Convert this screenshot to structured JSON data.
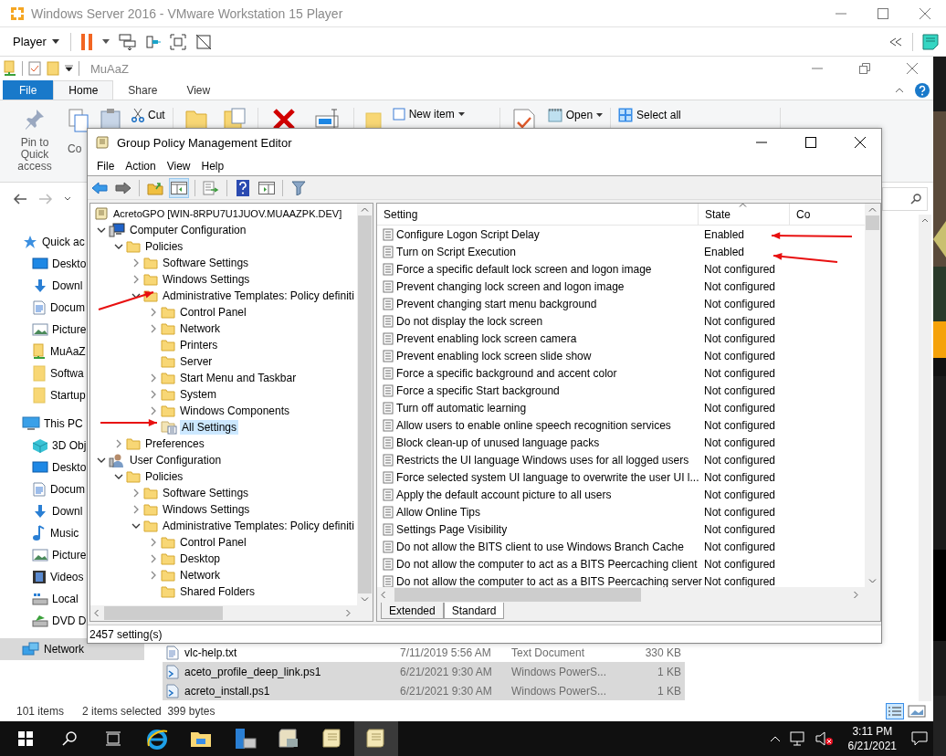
{
  "vmware": {
    "title": "Windows Server 2016 - VMware Workstation 15 Player",
    "menu": "Player"
  },
  "explorer": {
    "title": "MuAaZ",
    "tabs": [
      {
        "label": "File",
        "kind": "file",
        "selected": false
      },
      {
        "label": "Home",
        "kind": "tab",
        "selected": true
      },
      {
        "label": "Share",
        "kind": "tab",
        "selected": false
      },
      {
        "label": "View",
        "kind": "tab",
        "selected": false
      }
    ],
    "ribbon": {
      "pin": "Pin to Quick access",
      "copy": "Co",
      "cut": "Cut",
      "new_item": "New item",
      "open": "Open",
      "select_all": "Select all"
    },
    "nav": [
      {
        "label": "Quick ac",
        "kind": "star",
        "selected": false,
        "children": [
          {
            "label": "Deskto",
            "kind": "desktop",
            "selected": false
          },
          {
            "label": "Downl",
            "kind": "download",
            "selected": false
          },
          {
            "label": "Docum",
            "kind": "doc",
            "selected": false
          },
          {
            "label": "Picture",
            "kind": "pictures",
            "selected": false
          },
          {
            "label": "MuAaZ",
            "kind": "share",
            "selected": false
          },
          {
            "label": "Softwa",
            "kind": "folder",
            "selected": false
          },
          {
            "label": "Startup",
            "kind": "folder",
            "selected": false
          }
        ]
      },
      {
        "label": "This PC",
        "kind": "pc",
        "selected": false,
        "children": [
          {
            "label": "3D Obj",
            "kind": "cube",
            "selected": false
          },
          {
            "label": "Deskto",
            "kind": "desktop",
            "selected": false
          },
          {
            "label": "Docum",
            "kind": "doc",
            "selected": false
          },
          {
            "label": "Downl",
            "kind": "download",
            "selected": false
          },
          {
            "label": "Music",
            "kind": "music",
            "selected": false
          },
          {
            "label": "Picture",
            "kind": "pictures",
            "selected": false
          },
          {
            "label": "Videos",
            "kind": "video",
            "selected": false
          },
          {
            "label": "Local",
            "kind": "drive",
            "selected": false
          },
          {
            "label": "DVD D",
            "kind": "dvd",
            "selected": false
          }
        ]
      },
      {
        "label": "Network",
        "kind": "network",
        "selected": true
      }
    ],
    "files": [
      {
        "name": "vlc-help.txt",
        "kind": "text",
        "date": "7/11/2019 5:56 AM",
        "type": "Text Document",
        "size": "330 KB",
        "selected": false
      },
      {
        "name": "aceto_profile_deep_link.ps1",
        "kind": "script",
        "date": "6/21/2021 9:30 AM",
        "type": "Windows PowerS...",
        "size": "1 KB",
        "selected": true
      },
      {
        "name": "acreto_install.ps1",
        "kind": "script",
        "date": "6/21/2021 9:30 AM",
        "type": "Windows PowerS...",
        "size": "1 KB",
        "selected": true
      }
    ],
    "status": {
      "count": "101 items",
      "selection": "2 items selected  399 bytes"
    }
  },
  "gpme": {
    "title": "Group Policy Management Editor",
    "menu": [
      "File",
      "Action",
      "View",
      "Help"
    ],
    "tree": [
      {
        "label": "AcretoGPO [WIN-8RPU7U1JUOV.MUAAZPK.DEV]",
        "kind": "root",
        "selected": false,
        "children": [
          {
            "label": "Computer Configuration",
            "kind": "computer",
            "expanded": true,
            "selected": false,
            "children": [
              {
                "label": "Policies",
                "kind": "folder",
                "expanded": true,
                "selected": false,
                "children": [
                  {
                    "label": "Software Settings",
                    "kind": "folder",
                    "expanded": false,
                    "selected": false
                  },
                  {
                    "label": "Windows Settings",
                    "kind": "folder",
                    "expanded": false,
                    "selected": false
                  },
                  {
                    "label": "Administrative Templates: Policy definiti",
                    "kind": "folder",
                    "expanded": true,
                    "selected": false,
                    "children": [
                      {
                        "label": "Control Panel",
                        "kind": "folder",
                        "expanded": false,
                        "selected": false
                      },
                      {
                        "label": "Network",
                        "kind": "folder",
                        "expanded": false,
                        "selected": false
                      },
                      {
                        "label": "Printers",
                        "kind": "folder",
                        "selected": false
                      },
                      {
                        "label": "Server",
                        "kind": "folder",
                        "selected": false
                      },
                      {
                        "label": "Start Menu and Taskbar",
                        "kind": "folder",
                        "expanded": false,
                        "selected": false
                      },
                      {
                        "label": "System",
                        "kind": "folder",
                        "expanded": false,
                        "selected": false
                      },
                      {
                        "label": "Windows Components",
                        "kind": "folder",
                        "expanded": false,
                        "selected": false
                      },
                      {
                        "label": "All Settings",
                        "kind": "settings",
                        "selected": true
                      }
                    ]
                  }
                ]
              },
              {
                "label": "Preferences",
                "kind": "folder",
                "expanded": false,
                "selected": false
              }
            ]
          },
          {
            "label": "User Configuration",
            "kind": "user",
            "expanded": true,
            "selected": false,
            "children": [
              {
                "label": "Policies",
                "kind": "folder",
                "expanded": true,
                "selected": false,
                "children": [
                  {
                    "label": "Software Settings",
                    "kind": "folder",
                    "expanded": false,
                    "selected": false
                  },
                  {
                    "label": "Windows Settings",
                    "kind": "folder",
                    "expanded": false,
                    "selected": false
                  },
                  {
                    "label": "Administrative Templates: Policy definiti",
                    "kind": "folder",
                    "expanded": true,
                    "selected": false,
                    "children": [
                      {
                        "label": "Control Panel",
                        "kind": "folder",
                        "expanded": false,
                        "selected": false
                      },
                      {
                        "label": "Desktop",
                        "kind": "folder",
                        "expanded": false,
                        "selected": false
                      },
                      {
                        "label": "Network",
                        "kind": "folder",
                        "expanded": false,
                        "selected": false
                      },
                      {
                        "label": "Shared Folders",
                        "kind": "folder",
                        "selected": false
                      }
                    ]
                  }
                ]
              }
            ]
          }
        ]
      }
    ],
    "columns": [
      "Setting",
      "State",
      "Co"
    ],
    "rows": [
      {
        "setting": "Configure Logon Script Delay",
        "state": "Enabled"
      },
      {
        "setting": "Turn on Script Execution",
        "state": "Enabled"
      },
      {
        "setting": "Force a specific default lock screen and logon image",
        "state": "Not configured"
      },
      {
        "setting": "Prevent changing lock screen and logon image",
        "state": "Not configured"
      },
      {
        "setting": "Prevent changing start menu background",
        "state": "Not configured"
      },
      {
        "setting": "Do not display the lock screen",
        "state": "Not configured"
      },
      {
        "setting": "Prevent enabling lock screen camera",
        "state": "Not configured"
      },
      {
        "setting": "Prevent enabling lock screen slide show",
        "state": "Not configured"
      },
      {
        "setting": "Force a specific background and accent color",
        "state": "Not configured"
      },
      {
        "setting": "Force a specific Start background",
        "state": "Not configured"
      },
      {
        "setting": "Turn off automatic learning",
        "state": "Not configured"
      },
      {
        "setting": "Allow users to enable online speech recognition services",
        "state": "Not configured"
      },
      {
        "setting": "Block clean-up of unused language packs",
        "state": "Not configured"
      },
      {
        "setting": "Restricts the UI language Windows uses for all logged users",
        "state": "Not configured"
      },
      {
        "setting": "Force selected system UI language to overwrite the user UI l...",
        "state": "Not configured"
      },
      {
        "setting": "Apply the default account picture to all users",
        "state": "Not configured"
      },
      {
        "setting": "Allow Online Tips",
        "state": "Not configured"
      },
      {
        "setting": "Settings Page Visibility",
        "state": "Not configured"
      },
      {
        "setting": "Do not allow the BITS client to use Windows Branch Cache",
        "state": "Not configured"
      },
      {
        "setting": "Do not allow the computer to act as a BITS Peercaching client",
        "state": "Not configured"
      },
      {
        "setting": "Do not allow the computer to act as a BITS Peercaching server",
        "state": "Not configured"
      }
    ],
    "tabs": [
      {
        "label": "Extended",
        "selected": false
      },
      {
        "label": "Standard",
        "selected": true
      }
    ],
    "status": "2457 setting(s)"
  },
  "taskbar": {
    "time": "3:11 PM",
    "date": "6/21/2021"
  }
}
